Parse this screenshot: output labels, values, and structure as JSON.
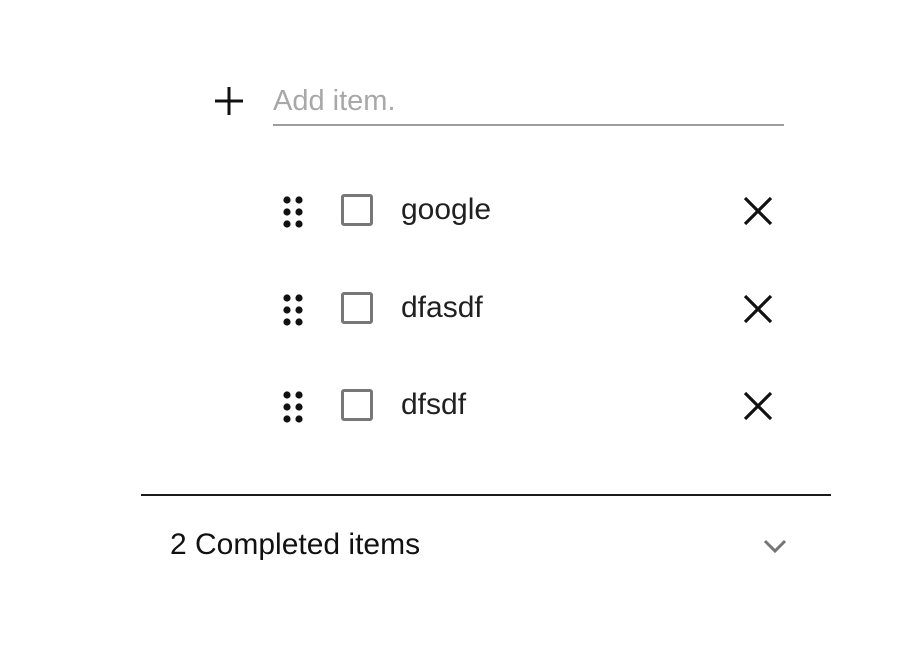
{
  "add_item": {
    "placeholder": "Add item.",
    "value": "",
    "icon": "plus-icon"
  },
  "items": [
    {
      "label": "google",
      "checked": false,
      "drag_icon": "drag-handle-icon",
      "delete_icon": "close-icon"
    },
    {
      "label": "dfasdf",
      "checked": false,
      "drag_icon": "drag-handle-icon",
      "delete_icon": "close-icon"
    },
    {
      "label": "dfsdf",
      "checked": false,
      "drag_icon": "drag-handle-icon",
      "delete_icon": "close-icon"
    }
  ],
  "completed": {
    "label": "2 Completed items",
    "expanded": false,
    "icon": "chevron-down-icon"
  },
  "colors": {
    "text": "#202020",
    "placeholder": "#a8a8a8",
    "checkbox_border": "#777777",
    "underline": "#9e9e9e",
    "divider": "#1a1a1a",
    "chevron": "#757575"
  }
}
